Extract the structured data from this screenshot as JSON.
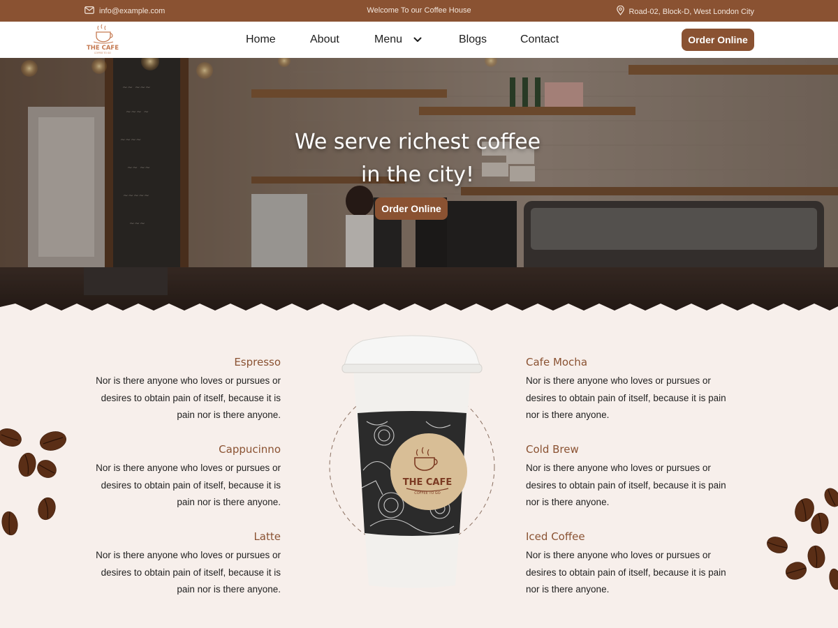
{
  "topbar": {
    "email": "info@example.com",
    "welcome": "Welcome To our Coffee House",
    "address": "Road-02, Block-D, West London City",
    "email_icon": "mail-icon",
    "address_icon": "map-pin-icon"
  },
  "brand": {
    "logo_text": "THE CAFE",
    "logo_tagline": "COFFEE TO GO"
  },
  "nav": {
    "items": [
      {
        "label": "Home"
      },
      {
        "label": "About"
      },
      {
        "label": "Menu",
        "has_dropdown": true
      },
      {
        "label": "Blogs"
      },
      {
        "label": "Contact"
      }
    ],
    "order_button": "Order Online"
  },
  "hero": {
    "title_line1": "We serve richest coffee",
    "title_line2": "in the city!",
    "button": "Order Online"
  },
  "menu_left": [
    {
      "name": "Espresso",
      "description": "Nor is there anyone who loves or pursues or desires to obtain pain of itself, because it is pain nor is there anyone."
    },
    {
      "name": "Cappucinno",
      "description": "Nor is there anyone who loves or pursues or desires to obtain pain of itself, because it is pain nor is there anyone."
    },
    {
      "name": "Latte",
      "description": "Nor is there anyone who loves or pursues or desires to obtain pain of itself, because it is pain nor is there anyone."
    }
  ],
  "menu_right": [
    {
      "name": "Cafe Mocha",
      "description": "Nor is there anyone who loves or pursues or desires to obtain pain of itself, because it is pain nor is there anyone."
    },
    {
      "name": "Cold Brew",
      "description": "Nor is there anyone who loves or pursues or desires to obtain pain of itself, because it is pain nor is there anyone."
    },
    {
      "name": "Iced Coffee",
      "description": "Nor is there anyone who loves or pursues or desires to obtain pain of itself, because it is pain nor is there anyone."
    }
  ],
  "cup": {
    "brand": "THE CAFE",
    "tagline": "COFFEE TO GO"
  },
  "colors": {
    "brand_brown": "#8a5232",
    "section_bg": "#f7efeb",
    "cup_label": "#d8be96"
  }
}
